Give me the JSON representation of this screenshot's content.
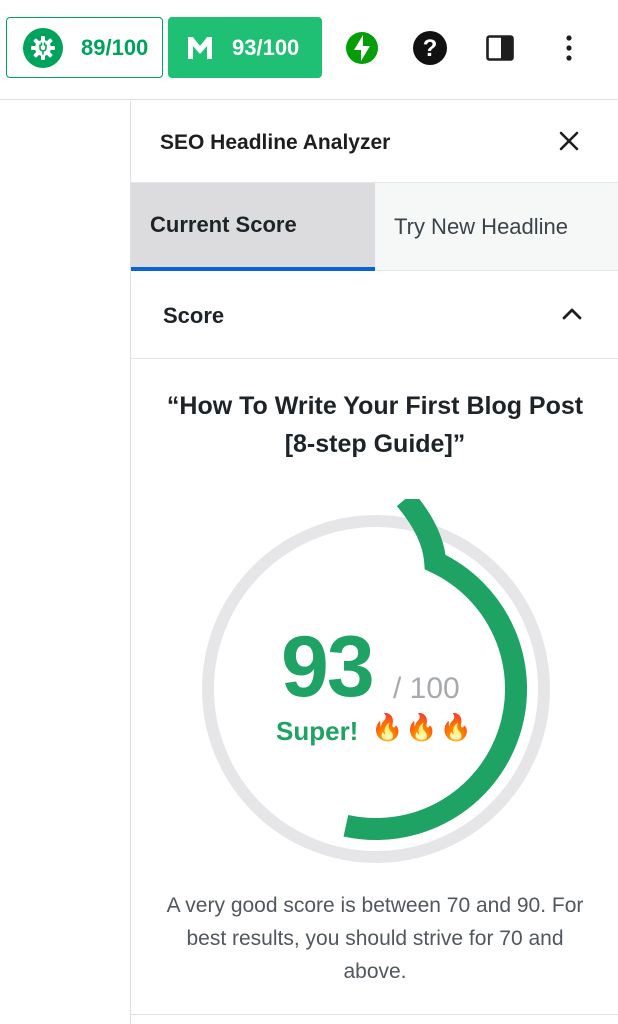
{
  "toolbar": {
    "aioseo_score": "89/100",
    "monsterinsights_score": "93/100",
    "icons": [
      "aioseo-gear-icon",
      "monsterinsights-logo-icon",
      "jetpack-bolt-icon",
      "help-icon",
      "sidebar-toggle-icon",
      "more-options-icon"
    ]
  },
  "panel": {
    "title": "SEO Headline Analyzer",
    "close_icon": "close-icon"
  },
  "tabs": [
    {
      "label": "Current Score",
      "active": true
    },
    {
      "label": "Try New Headline",
      "active": false
    }
  ],
  "section": {
    "title": "Score",
    "expanded": true
  },
  "analysis": {
    "headline": "“How To Write Your First Blog Post [8-step Guide]”",
    "score": "93",
    "score_max": "/ 100",
    "score_fraction": 0.93,
    "rating": "Super!",
    "rating_emoji": "🔥🔥🔥",
    "description": "A very good score is between 70 and 90. For best results, you should strive for 70 and above."
  },
  "colors": {
    "accent_green": "#1fa364",
    "badge_green": "#1fbf74",
    "tab_underline": "#0a63d6",
    "gauge_track": "#e6e6e8"
  }
}
